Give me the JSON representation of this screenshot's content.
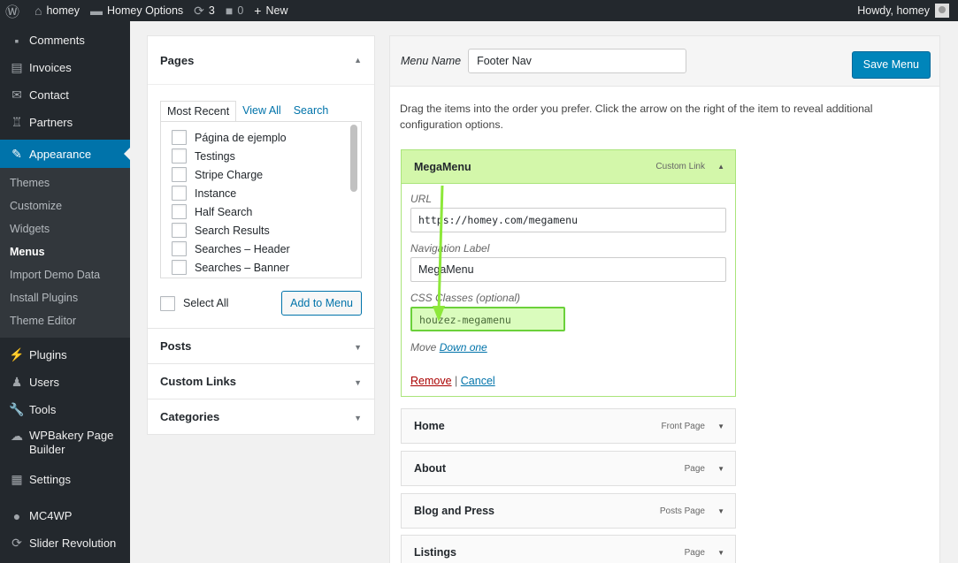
{
  "adminbar": {
    "site_name": "homey",
    "options_label": "Homey Options",
    "updates_count": "3",
    "comments_count": "0",
    "new_label": "New",
    "howdy": "Howdy, homey"
  },
  "sidebar": {
    "items_top": [
      {
        "label": "Comments",
        "icon": "comment-icon"
      },
      {
        "label": "Invoices",
        "icon": "invoice-icon"
      },
      {
        "label": "Contact",
        "icon": "mail-icon"
      },
      {
        "label": "Partners",
        "icon": "partners-icon"
      }
    ],
    "current": {
      "label": "Appearance",
      "icon": "brush-icon"
    },
    "submenu": [
      "Themes",
      "Customize",
      "Widgets",
      "Menus",
      "Import Demo Data",
      "Install Plugins",
      "Theme Editor"
    ],
    "submenu_active": "Menus",
    "items_bottom": [
      {
        "label": "Plugins",
        "icon": "plugin-icon"
      },
      {
        "label": "Users",
        "icon": "user-icon"
      },
      {
        "label": "Tools",
        "icon": "wrench-icon"
      },
      {
        "label": "WPBakery Page Builder",
        "icon": "cloud-icon"
      },
      {
        "label": "Settings",
        "icon": "settings-icon"
      },
      {
        "label": "MC4WP",
        "icon": "mc4wp-icon"
      },
      {
        "label": "Slider Revolution",
        "icon": "refresh-icon"
      }
    ]
  },
  "add_items": {
    "pages_title": "Pages",
    "tabs": [
      "Most Recent",
      "View All",
      "Search"
    ],
    "pages": [
      "Página de ejemplo",
      "Testings",
      "Stripe Charge",
      "Instance",
      "Half Search",
      "Search Results",
      "Searches – Header",
      "Searches – Banner"
    ],
    "select_all": "Select All",
    "add_button": "Add to Menu",
    "sections": [
      "Posts",
      "Custom Links",
      "Categories"
    ]
  },
  "menu_structure": {
    "name_label": "Menu Name",
    "name_value": "Footer Nav",
    "save_label": "Save Menu",
    "instructions": "Drag the items into the order you prefer. Click the arrow on the right of the item to reveal additional configuration options.",
    "open_item": {
      "title": "MegaMenu",
      "type": "Custom Link",
      "url_label": "URL",
      "url_value": "https://homey.com/megamenu",
      "nav_label": "Navigation Label",
      "nav_value": "MegaMenu",
      "css_label": "CSS Classes (optional)",
      "css_value": "houzez-megamenu",
      "move_label": "Move",
      "move_link": "Down one",
      "remove": "Remove",
      "separator": "|",
      "cancel": "Cancel"
    },
    "items": [
      {
        "title": "Home",
        "type": "Front Page"
      },
      {
        "title": "About",
        "type": "Page"
      },
      {
        "title": "Blog and Press",
        "type": "Posts Page"
      },
      {
        "title": "Listings",
        "type": "Page"
      }
    ]
  },
  "colors": {
    "adminbar_bg": "#23282d",
    "accent": "#0073aa",
    "highlight_green": "#d3f7aa",
    "arrow_green": "#8de83a"
  }
}
